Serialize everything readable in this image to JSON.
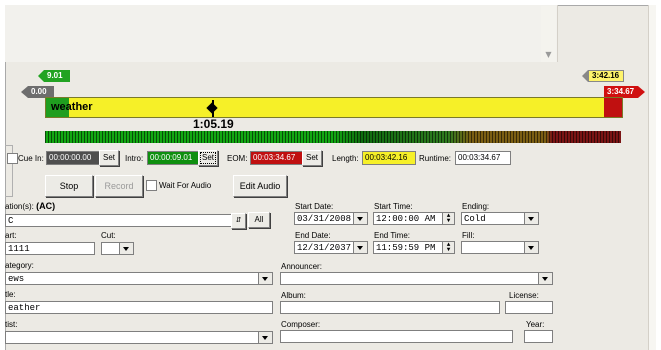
{
  "markers": {
    "intro_flag": "9.01",
    "cue_in_flag": "0.00",
    "length_flag": "3:42.16",
    "eom_flag": "3:34.67"
  },
  "waveform": {
    "title": "weather",
    "position_time": "1:05.19"
  },
  "cue": {
    "cue_in_label": "Cue In:",
    "cue_in_value": "00:00:00.00",
    "set_label": "Set",
    "intro_label": "Intro:",
    "intro_value": "00:00:09.01",
    "eom_label": "EOM:",
    "eom_value": "00:03:34.67",
    "length_label": "Length:",
    "length_value": "00:03:42.16",
    "runtime_label": "Runtime:",
    "runtime_value": "00:03:34.67"
  },
  "transport": {
    "stop_label": "Stop",
    "record_label": "Record",
    "wait_label": "Wait For Audio",
    "edit_label": "Edit Audio"
  },
  "form": {
    "stations_label": "ation(s):",
    "stations_value": "(AC)",
    "stations_input": "C",
    "all_label": "All",
    "cart_label": "art:",
    "cart_value": "1111",
    "cut_label": "Cut:",
    "category_label": "ategory:",
    "category_value": "ews",
    "title_label": "tle:",
    "title_value": "eather",
    "artist_label": "tist:",
    "announcer_label": "Announcer:",
    "album_label": "Album:",
    "license_label": "License:",
    "composer_label": "Composer:",
    "year_label": "Year:",
    "start_date_label": "Start Date:",
    "start_date_value": "03/31/2008",
    "start_time_label": "Start Time:",
    "start_time_value": "12:00:00 AM",
    "ending_label": "Ending:",
    "ending_value": "Cold",
    "end_date_label": "End Date:",
    "end_date_value": "12/31/2037",
    "end_time_label": "End Time:",
    "end_time_value": "11:59:59 PM",
    "fill_label": "Fill:"
  },
  "colors": {
    "intro_green": "#22a322",
    "eom_red": "#c01010",
    "length_yellow": "#fff46b",
    "waveform_yellow": "#f6f028"
  }
}
